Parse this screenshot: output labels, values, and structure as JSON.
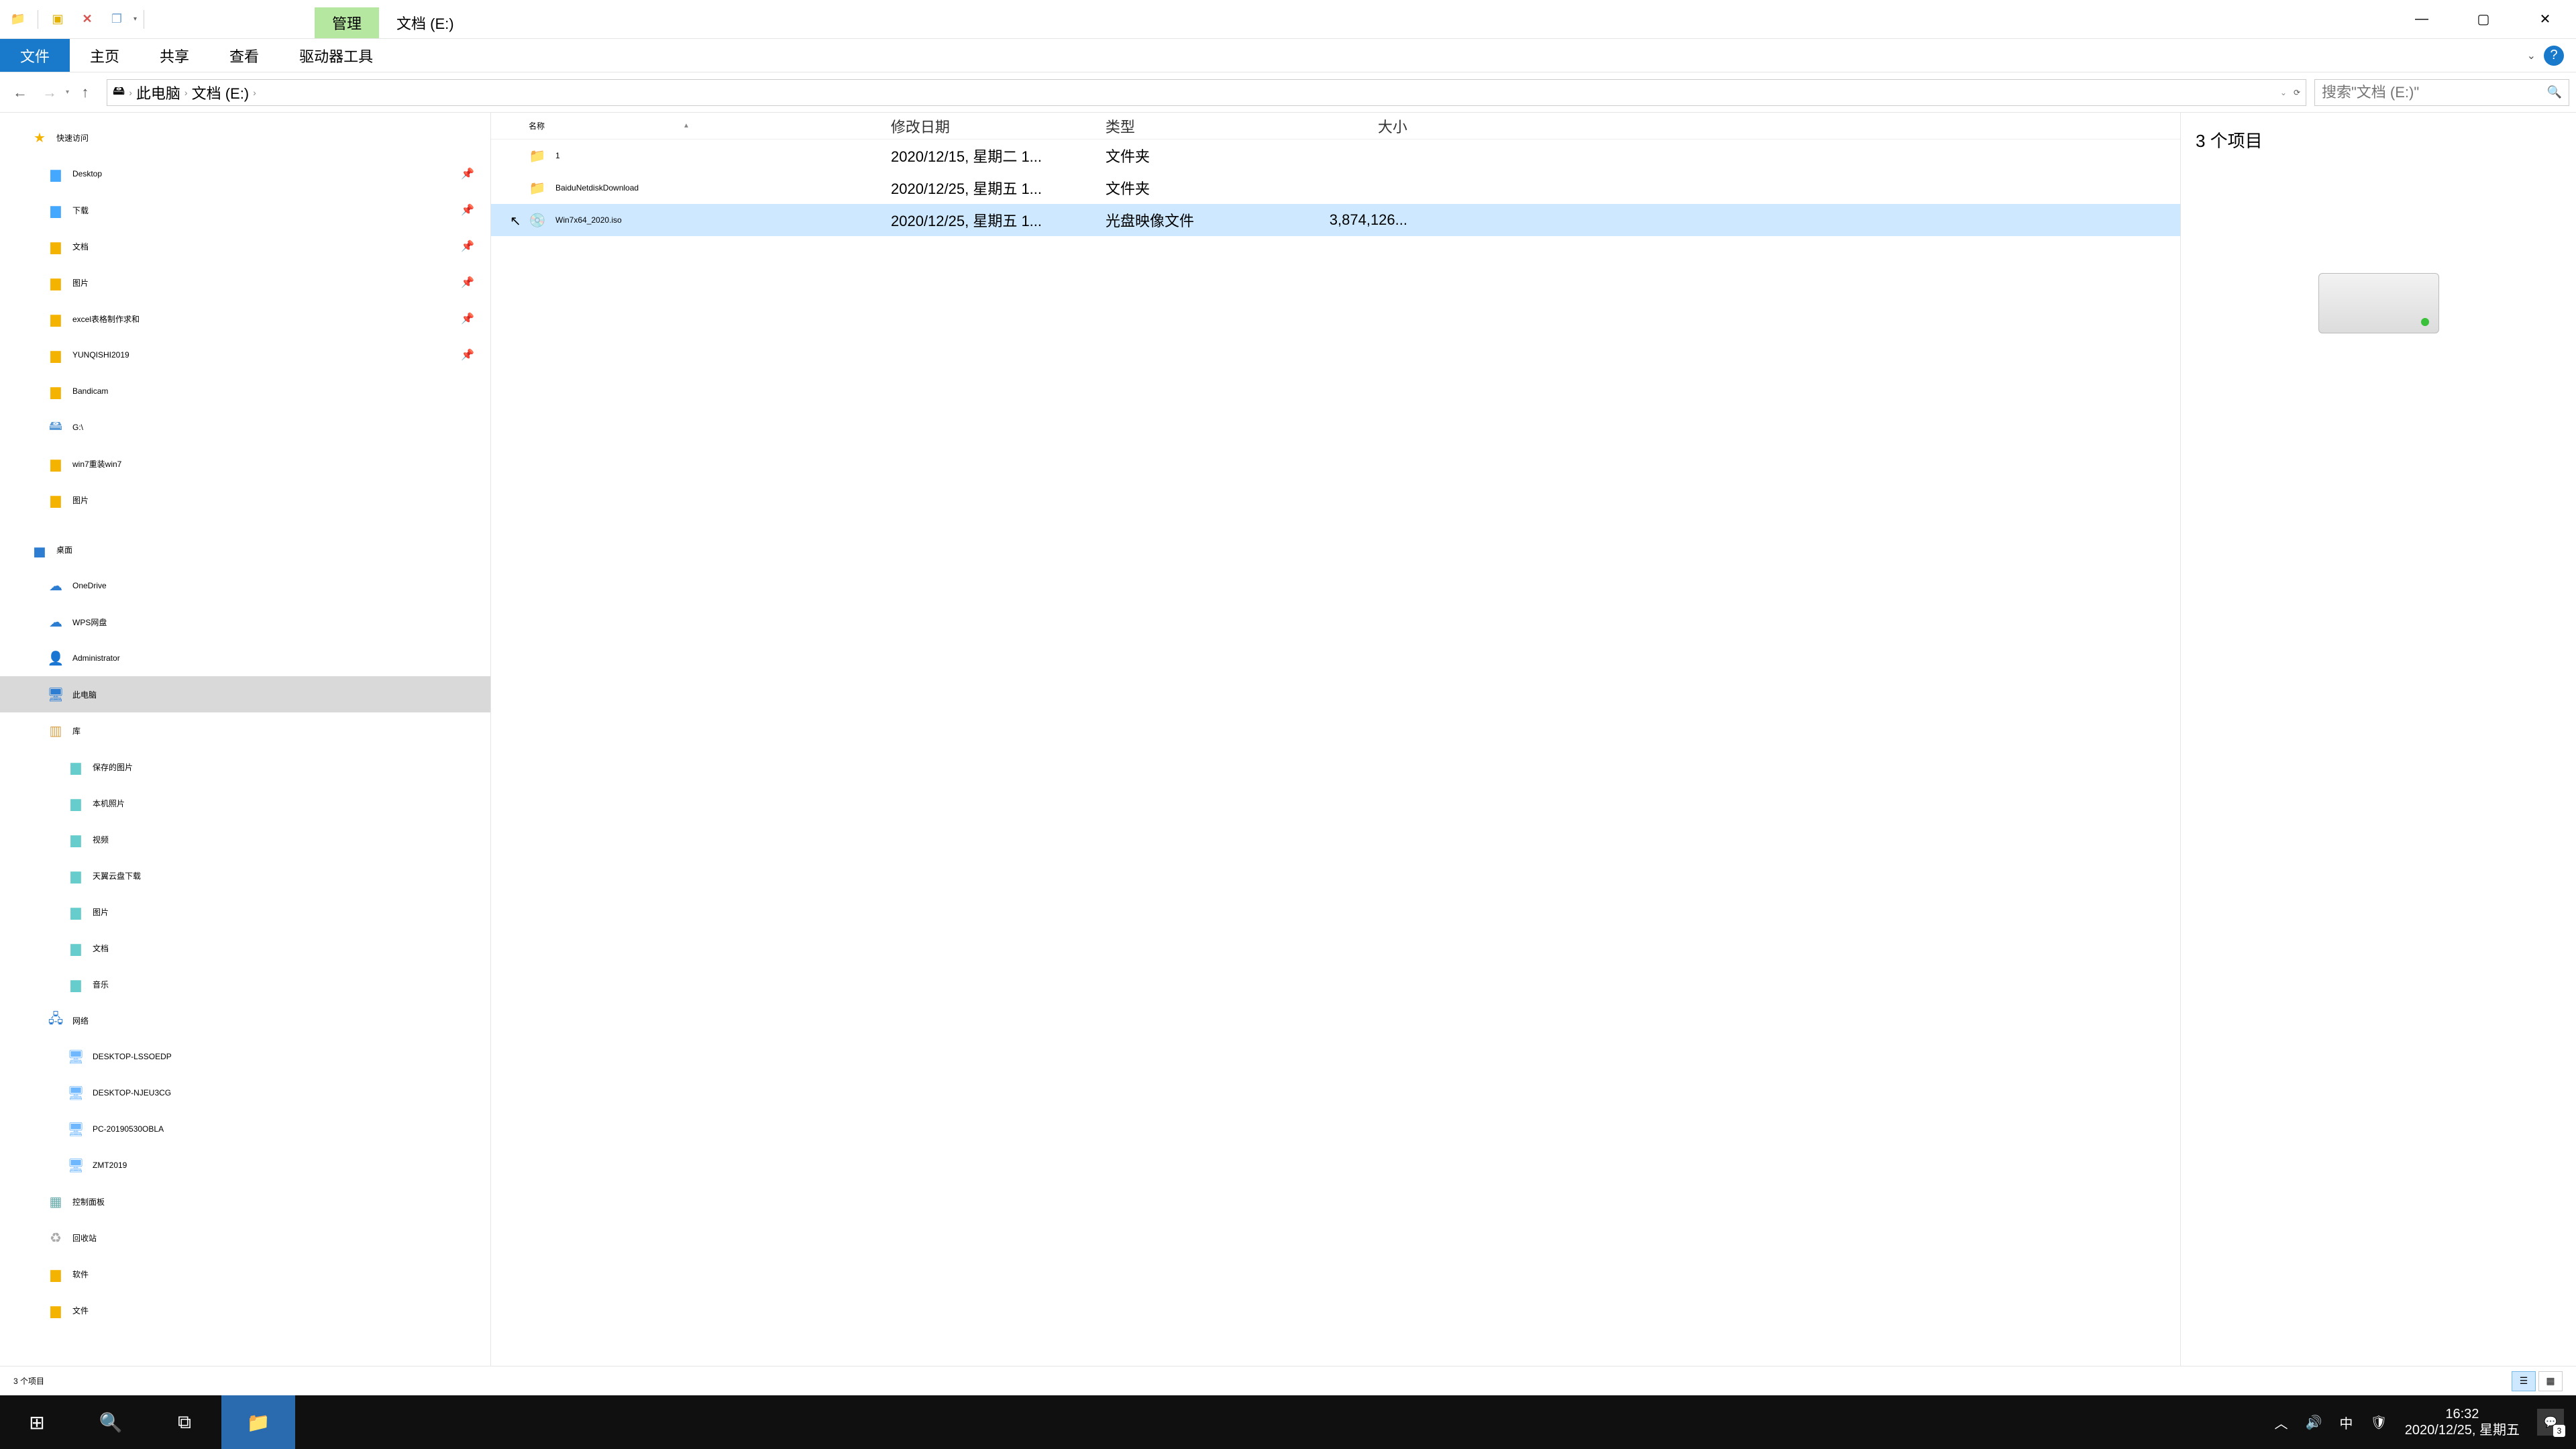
{
  "titlebar": {
    "context_tab": "管理",
    "location_tab": "文档 (E:)"
  },
  "ribbon": {
    "tabs": [
      "文件",
      "主页",
      "共享",
      "查看",
      "驱动器工具"
    ]
  },
  "breadcrumb": [
    "此电脑",
    "文档 (E:)"
  ],
  "search": {
    "placeholder": "搜索\"文档 (E:)\""
  },
  "tree": {
    "quick": "快速访问",
    "quick_items": [
      "Desktop",
      "下载",
      "文档",
      "图片",
      "excel表格制作求和",
      "YUNQISHI2019",
      "Bandicam",
      "G:\\",
      "win7重装win7",
      "图片"
    ],
    "desktop": "桌面",
    "desktop_items": [
      "OneDrive",
      "WPS网盘",
      "Administrator",
      "此电脑",
      "库"
    ],
    "lib_items": [
      "保存的图片",
      "本机照片",
      "视频",
      "天翼云盘下载",
      "图片",
      "文档",
      "音乐"
    ],
    "network": "网络",
    "network_items": [
      "DESKTOP-LSSOEDP",
      "DESKTOP-NJEU3CG",
      "PC-20190530OBLA",
      "ZMT2019"
    ],
    "extras": [
      "控制面板",
      "回收站",
      "软件",
      "文件"
    ]
  },
  "cols": {
    "name": "名称",
    "date": "修改日期",
    "type": "类型",
    "size": "大小"
  },
  "rows": [
    {
      "name": "1",
      "date": "2020/12/15, 星期二 1...",
      "type": "文件夹",
      "size": ""
    },
    {
      "name": "BaiduNetdiskDownload",
      "date": "2020/12/25, 星期五 1...",
      "type": "文件夹",
      "size": ""
    },
    {
      "name": "Win7x64_2020.iso",
      "date": "2020/12/25, 星期五 1...",
      "type": "光盘映像文件",
      "size": "3,874,126..."
    }
  ],
  "preview": {
    "title": "3 个项目"
  },
  "status": {
    "text": "3 个项目"
  },
  "tray": {
    "time": "16:32",
    "date": "2020/12/25, 星期五",
    "ime": "中",
    "notif_count": "3"
  }
}
